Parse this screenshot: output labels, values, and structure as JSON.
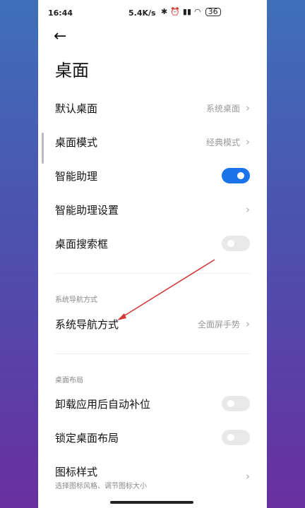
{
  "status_bar": {
    "time": "16:44",
    "speed": "5.4K/s",
    "battery": "36"
  },
  "page": {
    "back_icon": "back-arrow-icon",
    "title": "桌面"
  },
  "settings": {
    "default_desktop": {
      "label": "默认桌面",
      "value": "系统桌面"
    },
    "desktop_mode": {
      "label": "桌面模式",
      "value": "经典模式"
    },
    "smart_assistant": {
      "label": "智能助理",
      "enabled": true
    },
    "smart_assistant_settings": {
      "label": "智能助理设置"
    },
    "desktop_search_box": {
      "label": "桌面搜索框",
      "enabled": false
    },
    "nav_section_label": "系统导航方式",
    "system_navigation": {
      "label": "系统导航方式",
      "value": "全面屏手势"
    },
    "layout_section_label": "桌面布局",
    "auto_fill_after_uninstall": {
      "label": "卸载应用后自动补位",
      "enabled": false
    },
    "lock_desktop_layout": {
      "label": "锁定桌面布局",
      "enabled": false
    },
    "icon_style": {
      "label": "图标样式",
      "subtitle": "选择图标风格、调节图标大小"
    }
  },
  "colors": {
    "accent": "#1a73e8",
    "annotation": "#d23a3a"
  }
}
